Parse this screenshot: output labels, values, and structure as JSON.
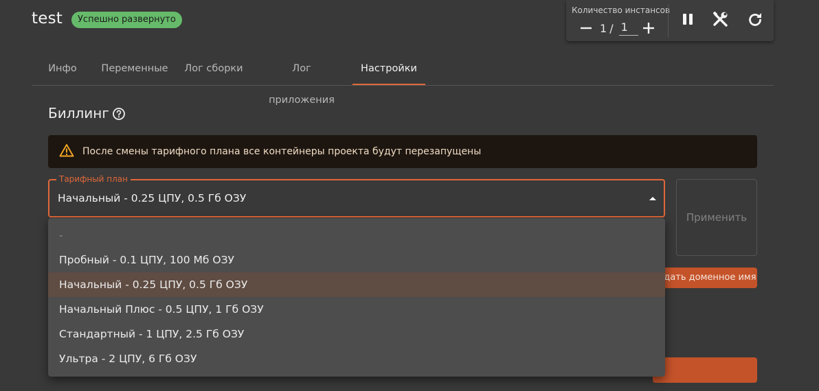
{
  "app": {
    "title": "test",
    "status": "Успешно развернуто"
  },
  "instances": {
    "label": "Количество инстансов",
    "current": "1",
    "separator": "/",
    "max_value": "1"
  },
  "tabs": [
    {
      "label": "Инфо"
    },
    {
      "label": "Переменные"
    },
    {
      "label": "Лог сборки"
    },
    {
      "label": "Лог приложения"
    },
    {
      "label": "Настройки",
      "active": true
    }
  ],
  "billing": {
    "title": "Биллинг",
    "alert": "После смены тарифного плана все контейнеры проекта будут перезапущены",
    "plan_label": "Тарифный план",
    "plan_value": "Начальный - 0.25 ЦПУ, 0.5 Гб ОЗУ",
    "apply_label": "Применить",
    "domain_button_label": "Задать доменное имя",
    "options": [
      {
        "label": "-"
      },
      {
        "label": "Пробный - 0.1 ЦПУ, 100 Мб ОЗУ"
      },
      {
        "label": "Начальный - 0.25 ЦПУ, 0.5 Гб ОЗУ",
        "selected": true
      },
      {
        "label": "Начальный Плюс - 0.5 ЦПУ, 1 Гб ОЗУ"
      },
      {
        "label": "Стандартный - 1 ЦПУ, 2.5 Гб ОЗУ"
      },
      {
        "label": "Ультра - 2 ЦПУ, 6 Гб ОЗУ"
      }
    ]
  },
  "colors": {
    "accent": "#e0683a",
    "success": "#66bb6a",
    "background": "#393939",
    "warning_bg": "#1d1610"
  },
  "icons": [
    "minus-icon",
    "plus-icon",
    "pause-icon",
    "tools-icon",
    "restart-icon",
    "help-icon",
    "warning-icon",
    "caret-up-icon"
  ]
}
